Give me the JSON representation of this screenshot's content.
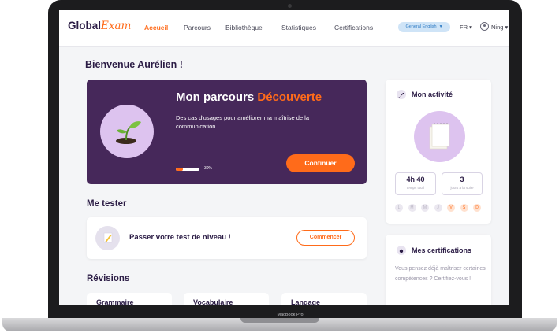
{
  "device": {
    "label": "MacBook Pro"
  },
  "nav": {
    "logo_main": "Global",
    "logo_accent": "Exam",
    "links": [
      "Accueil",
      "Parcours",
      "Bibliothèque",
      "Statistiques",
      "Certifications"
    ],
    "language_pill": "General English",
    "locale": "FR",
    "locale_chevron": "▾",
    "user_name": "Ning",
    "user_chevron": "▾"
  },
  "welcome": "Bienvenue Aurélien !",
  "hero": {
    "title_prefix": "Mon parcours",
    "title_highlight": "Découverte",
    "description": "Des cas d'usages pour améliorer ma maîtrise de la communication.",
    "progress_value": 0.3,
    "progress_text": "30%",
    "button": "Continuer"
  },
  "me_tester": {
    "title": "Me tester",
    "label": "Passer votre test de niveau !",
    "button": "Commencer"
  },
  "revisions": {
    "title": "Révisions",
    "cards": [
      "Grammaire",
      "Vocabulaire",
      "Langage"
    ]
  },
  "activity": {
    "title": "Mon activité",
    "stats": [
      {
        "value": "4h 40",
        "label": "temps total"
      },
      {
        "value": "3",
        "label": "jours à la suite"
      }
    ],
    "days": [
      {
        "letter": "L",
        "active": false
      },
      {
        "letter": "M",
        "active": false
      },
      {
        "letter": "M",
        "active": false
      },
      {
        "letter": "J",
        "active": false
      },
      {
        "letter": "V",
        "active": true
      },
      {
        "letter": "S",
        "active": true
      },
      {
        "letter": "D",
        "active": true
      }
    ]
  },
  "certifications": {
    "title": "Mes certifications",
    "text": "Vous pensez déjà maîtriser certaines compétences ? Certifiez-vous !"
  },
  "colors": {
    "brand_dark": "#2b1c45",
    "accent": "#ff6b1a",
    "hero_bg": "#46285a",
    "lilac": "#ddc3ef"
  }
}
